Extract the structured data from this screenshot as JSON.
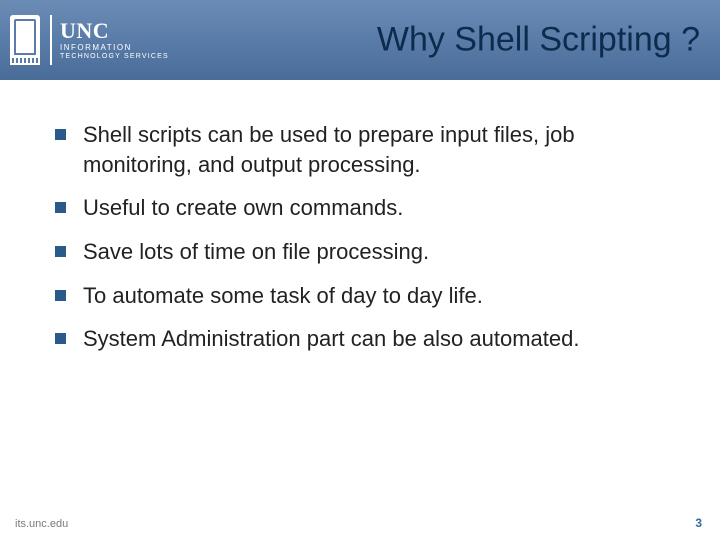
{
  "logo": {
    "main": "UNC",
    "sub1": "INFORMATION",
    "sub2": "TECHNOLOGY SERVICES"
  },
  "title": "Why Shell Scripting ?",
  "bullets": [
    "Shell scripts can be used to prepare input files,  job monitoring, and output processing.",
    "Useful to create own commands.",
    "Save lots of time on file processing.",
    "To automate some task of day to day life.",
    "System Administration part can be also automated."
  ],
  "footer": {
    "url": "its.unc.edu",
    "page": "3"
  }
}
